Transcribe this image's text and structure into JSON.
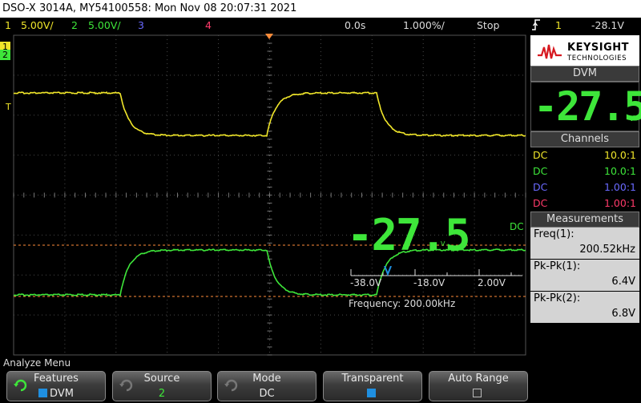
{
  "title": "DSO-X 3014A, MY54100558: Mon Nov 08 20:07:31 2021",
  "channel_bar": {
    "ch1_num": "1",
    "ch1_scale": "5.00V/",
    "ch2_num": "2",
    "ch2_scale": "5.00V/",
    "ch3_num": "3",
    "ch4_num": "4",
    "time_offset": "0.0s",
    "time_scale": "1.000%/",
    "run_state": "Stop",
    "trigger_icon": "trigger-edge-icon",
    "trigger_ch": "1",
    "trigger_level": "-28.1V"
  },
  "colors": {
    "ch1": "#f0e62a",
    "ch2": "#3ee63a",
    "ch3": "#6a6aff",
    "ch4": "#ff3a6a",
    "grid": "#555555"
  },
  "markers": {
    "ch1_ground": "1",
    "ch2_ground": "2",
    "trigger_marker": "T"
  },
  "overlay": {
    "dvm_value": "-27.5",
    "dvm_unit": "V",
    "dc_label": "DC",
    "scale_labels": [
      "-38.0V",
      "-18.0V",
      "2.00V"
    ],
    "frequency": "Frequency: 200.00kHz"
  },
  "sidebar": {
    "logo_brand": "KEYSIGHT",
    "logo_sub": "TECHNOLOGIES",
    "dvm_title": "DVM",
    "dvm_value": "-27.5",
    "dvm_unit": "V",
    "channels_title": "Channels",
    "channels": [
      {
        "coupling": "DC",
        "ratio": "10.0:1",
        "color": "#f0e62a"
      },
      {
        "coupling": "DC",
        "ratio": "10.0:1",
        "color": "#3ee63a"
      },
      {
        "coupling": "DC",
        "ratio": "1.00:1",
        "color": "#6a6aff"
      },
      {
        "coupling": "DC",
        "ratio": "1.00:1",
        "color": "#ff3a6a"
      }
    ],
    "measurements_title": "Measurements",
    "measurements": [
      {
        "label": "Freq(1):",
        "value": "200.52kHz"
      },
      {
        "label": "Pk-Pk(1):",
        "value": "6.4V"
      },
      {
        "label": "Pk-Pk(2):",
        "value": "6.8V"
      }
    ]
  },
  "menu": {
    "title": "Analyze Menu",
    "softkeys": [
      {
        "label": "Features",
        "value": "DVM"
      },
      {
        "label": "Source",
        "value": "2"
      },
      {
        "label": "Mode",
        "value": "DC"
      },
      {
        "label": "Transparent",
        "value": ""
      },
      {
        "label": "Auto Range",
        "value": ""
      }
    ]
  }
}
